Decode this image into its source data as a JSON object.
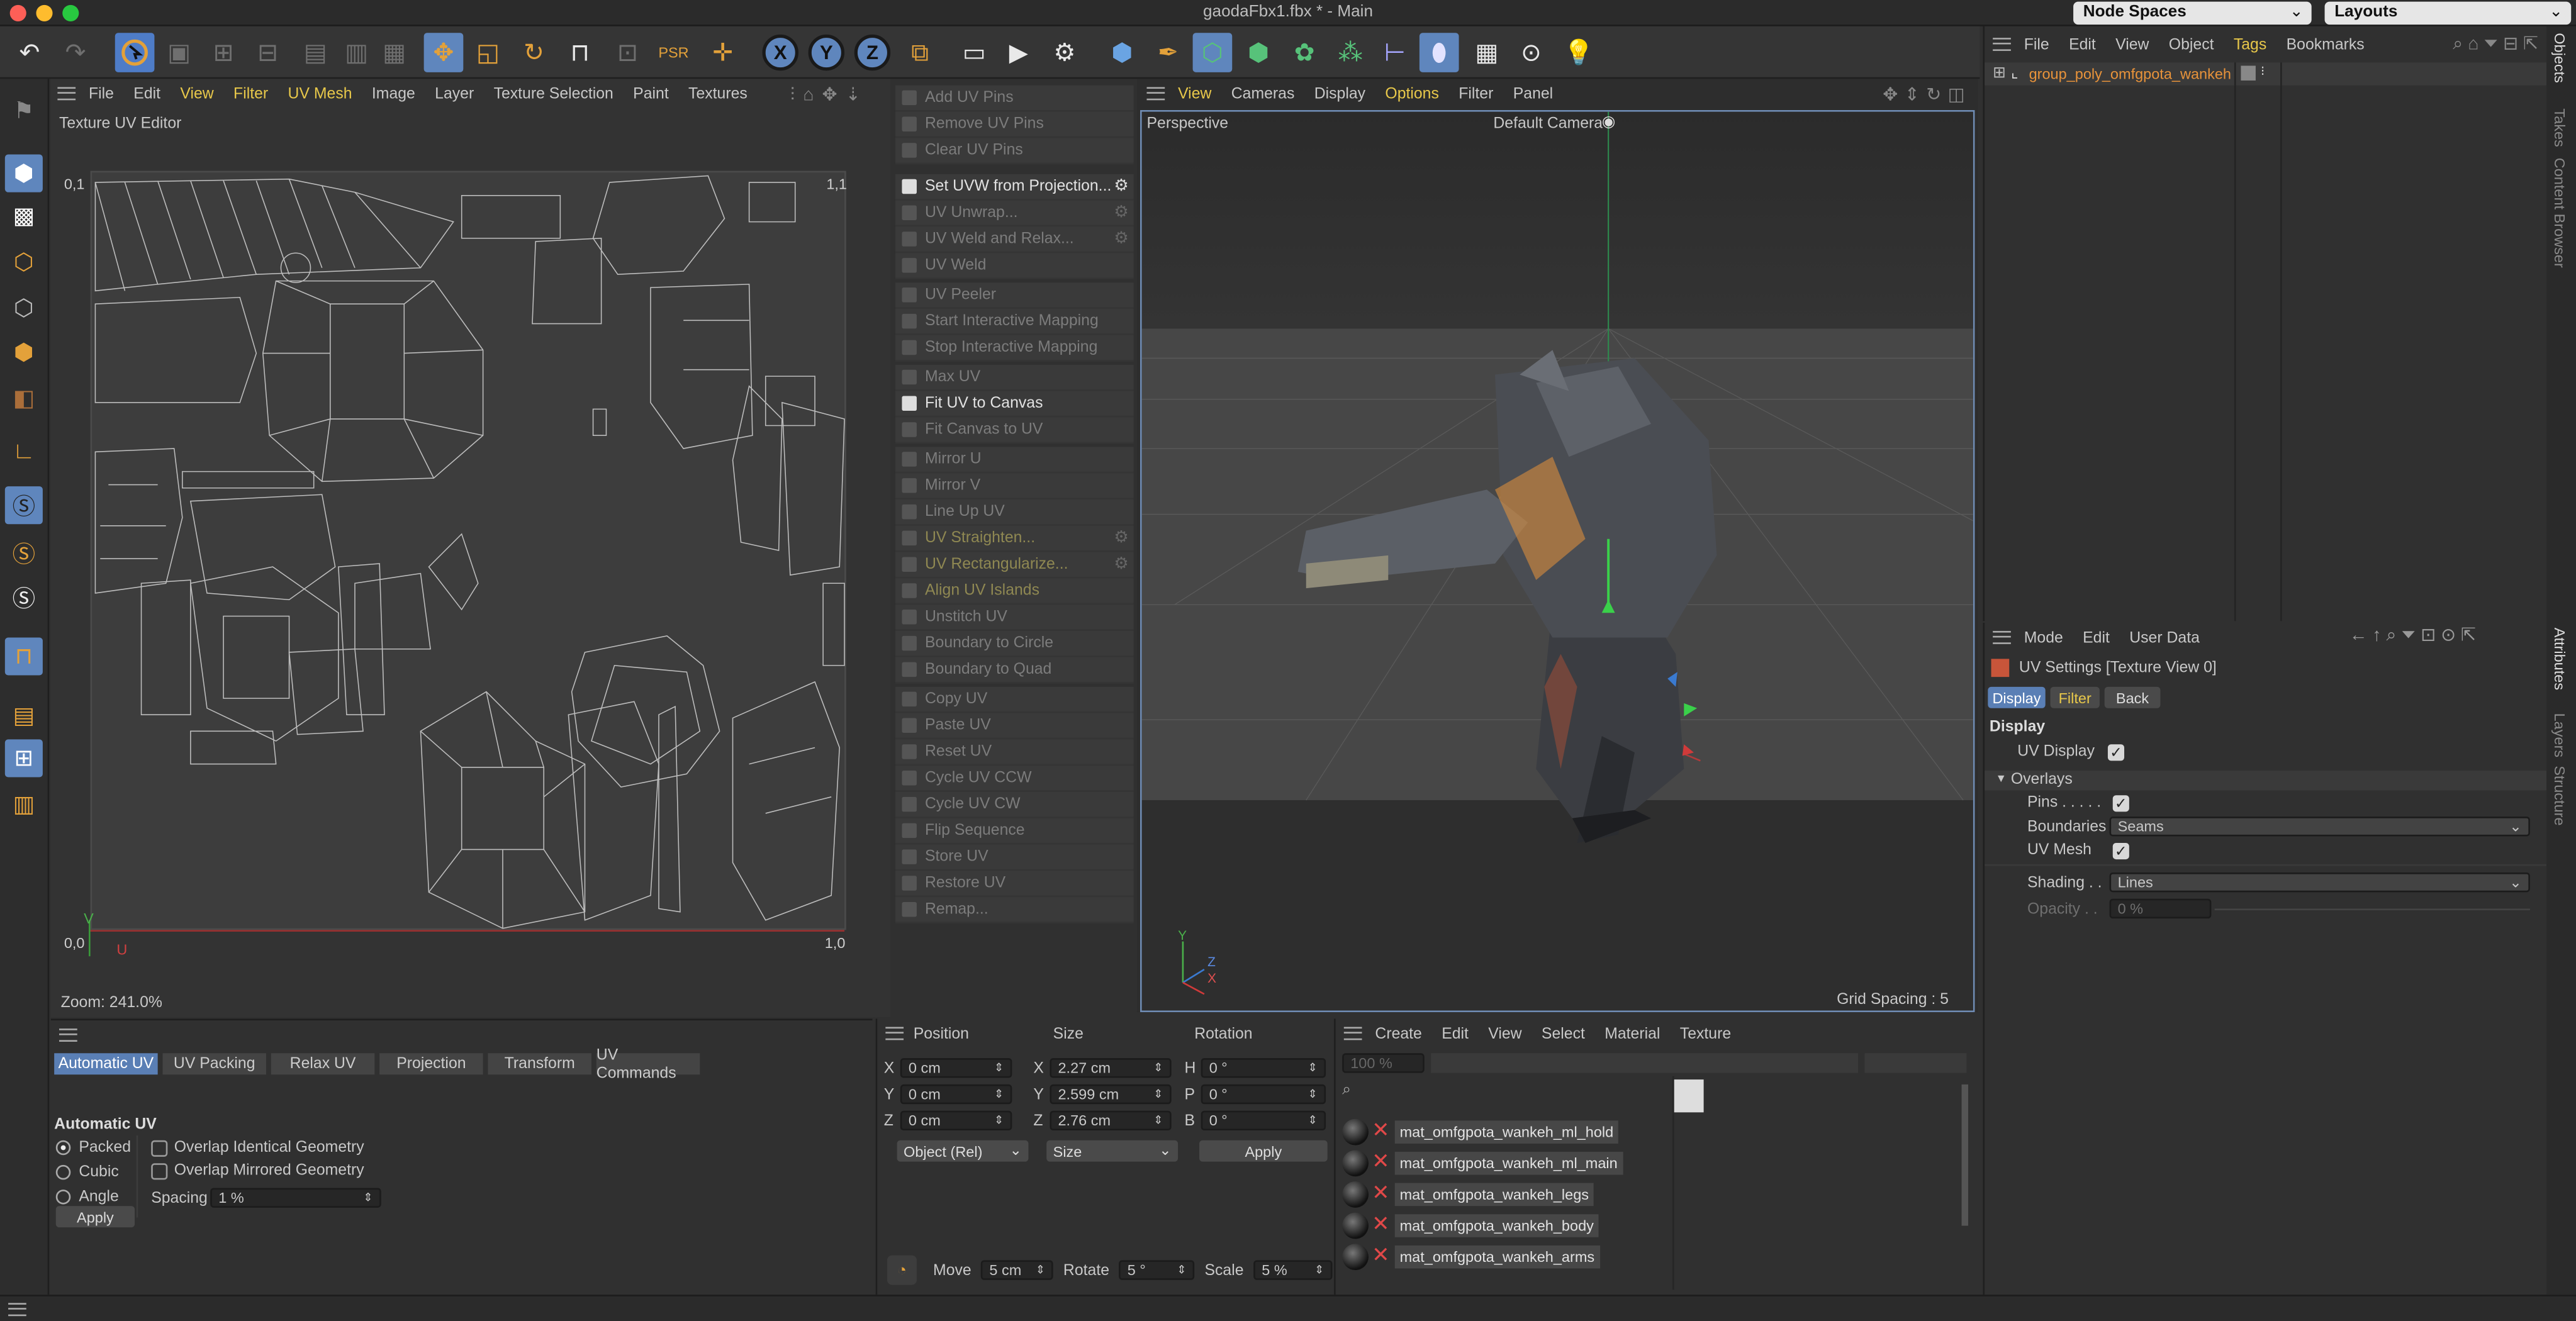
{
  "window": {
    "title": "gaodaFbx1.fbx * - Main",
    "node_spaces": "Node Spaces",
    "layouts": "Layouts"
  },
  "colors": {
    "accent_blue": "#5f86bd",
    "tool_gold": "#e3a13a",
    "menu_yellow": "#e8c84a",
    "error_red": "#e04848",
    "object_orange": "#e8933a"
  },
  "toolbar": {
    "icons": [
      "undo-icon",
      "redo-icon",
      "live-selection-icon",
      "disabled-icon",
      "disabled-icon",
      "disabled-icon",
      "disabled-icon",
      "disabled-icon",
      "disabled-icon",
      "move-icon",
      "scale-icon",
      "rotate-icon",
      "magnet-icon",
      "disabled-icon",
      "psr-icon",
      "axis-icon",
      "x-axis-icon",
      "y-axis-icon",
      "z-axis-icon",
      "coordinate-system-icon",
      "render-view-icon",
      "render-icon",
      "render-settings-icon",
      "cube-icon",
      "pen-icon",
      "subdivision-icon",
      "extrude-icon",
      "cloner-icon",
      "mograph-icon",
      "deformer-icon",
      "field-icon",
      "floor-icon",
      "camera-icon",
      "light-icon"
    ],
    "axis_x": "X",
    "axis_y": "Y",
    "axis_z": "Z"
  },
  "uv_editor": {
    "menu": [
      "File",
      "Edit",
      "View",
      "Filter",
      "UV Mesh",
      "Image",
      "Layer",
      "Texture Selection",
      "Paint",
      "Textures"
    ],
    "title": "Texture UV Editor",
    "corner_tl": "0,1",
    "corner_tr": "1,1",
    "corner_bl": "0,0",
    "corner_br": "1,0",
    "axis_u": "U",
    "axis_v": "V",
    "zoom": "Zoom: 241.0%"
  },
  "uv_commands": {
    "groups": [
      [
        {
          "label": "Add UV Pins",
          "enabled": false
        },
        {
          "label": "Remove UV Pins",
          "enabled": false
        },
        {
          "label": "Clear UV Pins",
          "enabled": false
        }
      ],
      [
        {
          "label": "Set UVW from Projection...",
          "enabled": true,
          "gear": true
        },
        {
          "label": "UV Unwrap...",
          "enabled": false,
          "gear": true
        },
        {
          "label": "UV Weld and Relax...",
          "enabled": false,
          "gear": true
        },
        {
          "label": "UV Weld",
          "enabled": false
        }
      ],
      [
        {
          "label": "UV Peeler",
          "enabled": false
        },
        {
          "label": "Start Interactive Mapping",
          "enabled": false
        },
        {
          "label": "Stop Interactive Mapping",
          "enabled": false
        }
      ],
      [
        {
          "label": "Max UV",
          "enabled": false
        },
        {
          "label": "Fit UV to Canvas",
          "enabled": true
        },
        {
          "label": "Fit Canvas to UV",
          "enabled": false
        }
      ],
      [
        {
          "label": "Mirror U",
          "enabled": false
        },
        {
          "label": "Mirror V",
          "enabled": false
        },
        {
          "label": "Line Up UV",
          "enabled": false
        },
        {
          "label": "UV Straighten...",
          "enabled": false,
          "gear": true,
          "yellow": true
        },
        {
          "label": "UV Rectangularize...",
          "enabled": false,
          "gear": true,
          "yellow": true
        },
        {
          "label": "Align UV Islands",
          "enabled": false,
          "yellow": true
        },
        {
          "label": "Unstitch UV",
          "enabled": false
        },
        {
          "label": "Boundary to Circle",
          "enabled": false
        },
        {
          "label": "Boundary to Quad",
          "enabled": false
        }
      ],
      [
        {
          "label": "Copy UV",
          "enabled": false
        },
        {
          "label": "Paste UV",
          "enabled": false
        },
        {
          "label": "Reset UV",
          "enabled": false
        },
        {
          "label": "Cycle UV CCW",
          "enabled": false
        },
        {
          "label": "Cycle UV CW",
          "enabled": false
        },
        {
          "label": "Flip Sequence",
          "enabled": false
        },
        {
          "label": "Store UV",
          "enabled": false
        },
        {
          "label": "Restore UV",
          "enabled": false
        },
        {
          "label": "Remap...",
          "enabled": false
        }
      ]
    ]
  },
  "viewport": {
    "menu": [
      "View",
      "Cameras",
      "Display",
      "Options",
      "Filter",
      "Panel"
    ],
    "label": "Perspective",
    "camera": "Default Camera",
    "grid_spacing": "Grid Spacing : 5 cm",
    "axis_x": "X",
    "axis_y": "Y",
    "axis_z": "Z"
  },
  "objects_panel": {
    "menu": [
      "File",
      "Edit",
      "View",
      "Object",
      "Tags",
      "Bookmarks"
    ],
    "object_name": "group_poly_omfgpota_wankeh"
  },
  "attributes_panel": {
    "menu": [
      "Mode",
      "Edit",
      "User Data"
    ],
    "title": "UV Settings [Texture View 0]",
    "tabs": [
      "Display",
      "Filter",
      "Back"
    ],
    "section_display": "Display",
    "uv_display": "UV Display",
    "overlays": "Overlays",
    "pins": "Pins . . . . .",
    "boundaries_label": "Boundaries",
    "boundaries_value": "Seams",
    "uv_mesh": "UV Mesh",
    "shading_label": "Shading . .",
    "shading_value": "Lines",
    "opacity_label": "Opacity . .",
    "opacity_value": "0 %"
  },
  "right_tabs": [
    "Objects",
    "Takes",
    "Content Browser",
    "Attributes",
    "Layers",
    "Structure"
  ],
  "auto_uv": {
    "tabs": [
      "Automatic UV",
      "UV Packing",
      "Relax UV",
      "Projection",
      "Transform",
      "UV Commands"
    ],
    "title": "Automatic UV",
    "radios": [
      "Packed",
      "Cubic",
      "Angle"
    ],
    "overlap_identical": "Overlap Identical Geometry",
    "overlap_mirrored": "Overlap Mirrored Geometry",
    "spacing_label": "Spacing",
    "spacing_value": "1 %",
    "apply": "Apply"
  },
  "coordinates": {
    "headers": [
      "Position",
      "Size",
      "Rotation"
    ],
    "rows": [
      {
        "axis": "X",
        "pos": "0 cm",
        "size_axis": "X",
        "size": "2.27 cm",
        "rot_axis": "H",
        "rot": "0 °"
      },
      {
        "axis": "Y",
        "pos": "0 cm",
        "size_axis": "Y",
        "size": "2.599 cm",
        "rot_axis": "P",
        "rot": "0 °"
      },
      {
        "axis": "Z",
        "pos": "0 cm",
        "size_axis": "Z",
        "size": "2.76 cm",
        "rot_axis": "B",
        "rot": "0 °"
      }
    ],
    "mode": "Object (Rel)",
    "size_mode": "Size",
    "apply": "Apply",
    "move_label": "Move",
    "move_value": "5 cm",
    "rotate_label": "Rotate",
    "rotate_value": "5 °",
    "scale_label": "Scale",
    "scale_value": "5 %"
  },
  "materials": {
    "menu": [
      "Create",
      "Edit",
      "View",
      "Select",
      "Material",
      "Texture"
    ],
    "zoom": "100 %",
    "items": [
      "mat_omfgpota_wankeh_ml_hold",
      "mat_omfgpota_wankeh_ml_main",
      "mat_omfgpota_wankeh_legs",
      "mat_omfgpota_wankeh_body",
      "mat_omfgpota_wankeh_arms"
    ]
  }
}
